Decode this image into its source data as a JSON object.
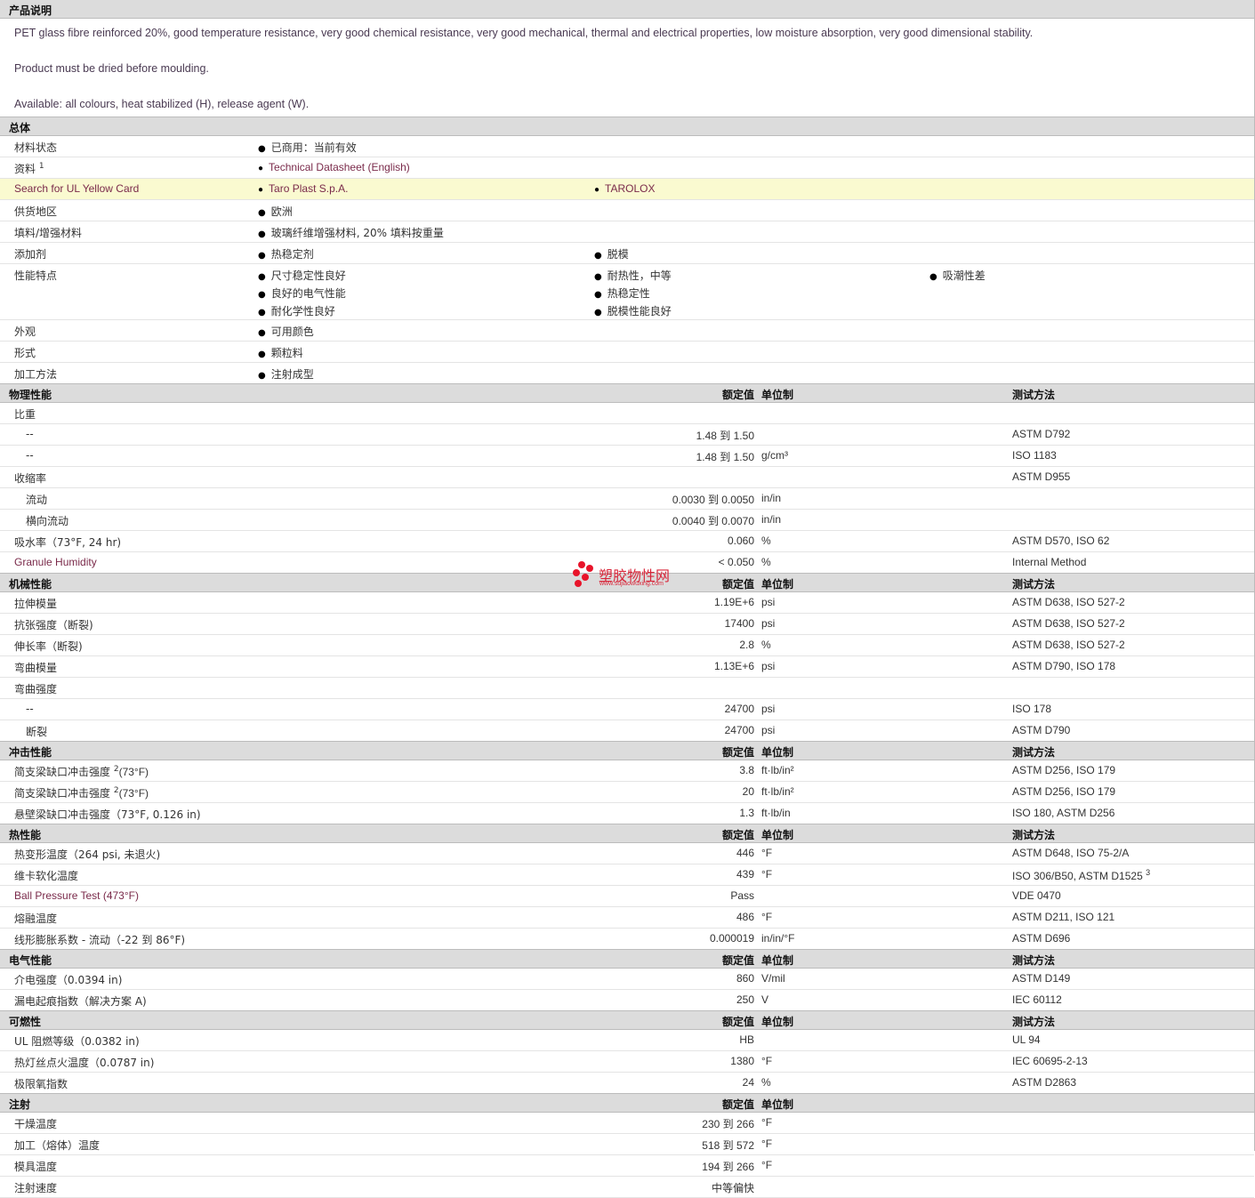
{
  "description": {
    "title": "产品说明",
    "line1": "PET glass fibre reinforced 20%, good temperature resistance, very good chemical resistance, very good mechanical, thermal and electrical properties, low moisture absorption, very good dimensional stability.",
    "line2": "Product must be dried before moulding.",
    "line3": "Available: all colours, heat stabilized (H), release agent (W)."
  },
  "general": {
    "title": "总体",
    "material_status": {
      "label": "材料状态",
      "value": "已商用：当前有效"
    },
    "resources": {
      "label": "资料",
      "sup": "1",
      "link": "Technical Datasheet (English)"
    },
    "ul_search": {
      "label": "Search for UL Yellow Card",
      "link1": "Taro Plast S.p.A.",
      "link2": "TAROLOX"
    },
    "region": {
      "label": "供货地区",
      "value": "欧洲"
    },
    "filler": {
      "label": "填料/增强材料",
      "value": "玻璃纤维增强材料, 20% 填料按重量"
    },
    "additive": {
      "label": "添加剂",
      "v1": "热稳定剂",
      "v2": "脱模"
    },
    "features": {
      "label": "性能特点",
      "items": [
        "尺寸稳定性良好",
        "耐热性，中等",
        "吸潮性差",
        "良好的电气性能",
        "热稳定性",
        "耐化学性良好",
        "脱模性能良好"
      ]
    },
    "appearance": {
      "label": "外观",
      "value": "可用颜色"
    },
    "form": {
      "label": "形式",
      "value": "颗粒料"
    },
    "processing": {
      "label": "加工方法",
      "value": "注射成型"
    }
  },
  "headers": {
    "nominal": "额定值",
    "unit": "单位制",
    "method": "测试方法"
  },
  "physical": {
    "title": "物理性能",
    "sg_label": "比重",
    "sg1": {
      "label": "--",
      "value": "1.48 到  1.50",
      "unit": "",
      "method": "ASTM D792"
    },
    "sg2": {
      "label": "--",
      "value": "1.48 到  1.50",
      "unit": "g/cm³",
      "method": "ISO 1183"
    },
    "shrink": {
      "label": "收缩率",
      "method": "ASTM D955"
    },
    "flow": {
      "label": "流动",
      "value": "0.0030 到  0.0050",
      "unit": "in/in"
    },
    "xflow": {
      "label": "横向流动",
      "value": "0.0040 到  0.0070",
      "unit": "in/in"
    },
    "water": {
      "label": "吸水率（73°F, 24 hr)",
      "value": "0.060",
      "unit": "%",
      "method": "ASTM D570, ISO 62"
    },
    "humidity": {
      "label": "Granule Humidity",
      "value": "< 0.050",
      "unit": "%",
      "method": "Internal Method"
    }
  },
  "mechanical": {
    "title": "机械性能",
    "tm": {
      "label": "拉伸模量",
      "value": "1.19E+6",
      "unit": "psi",
      "method": "ASTM D638, ISO 527-2"
    },
    "ts": {
      "label": "抗张强度（断裂)",
      "value": "17400",
      "unit": "psi",
      "method": "ASTM D638, ISO 527-2"
    },
    "el": {
      "label": "伸长率（断裂)",
      "value": "2.8",
      "unit": "%",
      "method": "ASTM D638, ISO 527-2"
    },
    "fm": {
      "label": "弯曲模量",
      "value": "1.13E+6",
      "unit": "psi",
      "method": "ASTM D790, ISO 178"
    },
    "fs": {
      "label": "弯曲强度"
    },
    "fs1": {
      "label": "--",
      "value": "24700",
      "unit": "psi",
      "method": "ISO 178"
    },
    "fs2": {
      "label": "断裂",
      "value": "24700",
      "unit": "psi",
      "method": "ASTM D790"
    }
  },
  "impact": {
    "title": "冲击性能",
    "c1": {
      "label": "简支梁缺口冲击强度",
      "sup": "2",
      "cond": "(73°F)",
      "value": "3.8",
      "unit": "ft·lb/in²",
      "method": "ASTM D256, ISO 179"
    },
    "c2": {
      "label": "简支梁缺口冲击强度",
      "sup": "2",
      "cond": "(73°F)",
      "value": "20",
      "unit": "ft·lb/in²",
      "method": "ASTM D256, ISO 179"
    },
    "iz": {
      "label": "悬壁梁缺口冲击强度（73°F, 0.126 in)",
      "value": "1.3",
      "unit": "ft·lb/in",
      "method": "ISO 180, ASTM D256"
    }
  },
  "thermal": {
    "title": "热性能",
    "hdt": {
      "label": "热变形温度（264 psi, 未退火)",
      "value": "446",
      "unit": "°F",
      "method": "ASTM D648, ISO 75-2/A"
    },
    "vicat": {
      "label": "维卡软化温度",
      "value": "439",
      "unit": "°F",
      "method": "ISO 306/B50, ASTM D1525",
      "sup": "3"
    },
    "ball": {
      "label": "Ball Pressure Test (473°F)",
      "value": "Pass",
      "method": "VDE 0470"
    },
    "melt": {
      "label": "熔融温度",
      "value": "486",
      "unit": "°F",
      "method": "ASTM D211, ISO 121"
    },
    "clte": {
      "label": "线形膨胀系数  - 流动（-22 到  86°F)",
      "value": "0.000019",
      "unit": "in/in/°F",
      "method": "ASTM D696"
    }
  },
  "electrical": {
    "title": "电气性能",
    "ds": {
      "label": "介电强度（0.0394 in)",
      "value": "860",
      "unit": "V/mil",
      "method": "ASTM D149"
    },
    "cti": {
      "label": "漏电起痕指数（解决方案  A)",
      "value": "250",
      "unit": "V",
      "method": "IEC 60112"
    }
  },
  "flammability": {
    "title": "可燃性",
    "ul": {
      "label": "UL 阻燃等级（0.0382 in)",
      "value": "HB",
      "method": "UL 94"
    },
    "gwit": {
      "label": "热灯丝点火温度（0.0787 in)",
      "value": "1380",
      "unit": "°F",
      "method": "IEC 60695-2-13"
    },
    "loi": {
      "label": "极限氧指数",
      "value": "24",
      "unit": "%",
      "method": "ASTM D2863"
    }
  },
  "injection": {
    "title": "注射",
    "dry": {
      "label": "干燥温度",
      "value": "230 到  266",
      "unit": "°F"
    },
    "proc": {
      "label": "加工（熔体）温度",
      "value": "518 到  572",
      "unit": "°F"
    },
    "mold": {
      "label": "模具温度",
      "value": "194 到  266",
      "unit": "°F"
    },
    "speed": {
      "label": "注射速度",
      "value": "中等偏快"
    }
  },
  "watermark": {
    "text": "塑胶物性网",
    "url": "www.sujiaowuxing.com"
  }
}
